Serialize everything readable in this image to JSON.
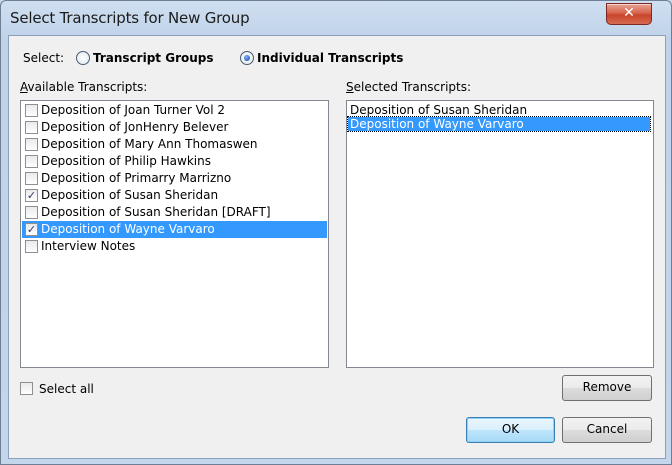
{
  "window": {
    "title": "Select Transcripts for New Group",
    "close_glyph": "✕"
  },
  "select": {
    "label": "Select:",
    "options": [
      {
        "label": "Transcript Groups",
        "selected": false
      },
      {
        "label": "Individual Transcripts",
        "selected": true
      }
    ]
  },
  "available": {
    "label_first": "A",
    "label_rest": "vailable Transcripts:",
    "items": [
      {
        "label": "Deposition of Joan Turner Vol 2",
        "checked": false
      },
      {
        "label": "Deposition of JonHenry Belever",
        "checked": false
      },
      {
        "label": "Deposition of Mary Ann Thomaswen",
        "checked": false
      },
      {
        "label": "Deposition of Philip Hawkins",
        "checked": false
      },
      {
        "label": "Deposition of Primarry Marrizno",
        "checked": false
      },
      {
        "label": "Deposition of Susan Sheridan",
        "checked": true
      },
      {
        "label": "Deposition of Susan Sheridan [DRAFT]",
        "checked": false
      },
      {
        "label": "Deposition of Wayne Varvaro",
        "checked": true,
        "highlighted": true
      },
      {
        "label": "Interview Notes",
        "checked": false
      }
    ]
  },
  "selected": {
    "label_first": "S",
    "label_rest": "elected Transcripts:",
    "items": [
      {
        "label": "Deposition of Susan Sheridan"
      },
      {
        "label": "Deposition of Wayne Varvaro",
        "highlighted": true
      }
    ]
  },
  "select_all": {
    "label": "Select all",
    "checked": false
  },
  "buttons": {
    "remove": "Remove",
    "ok": "OK",
    "cancel": "Cancel"
  },
  "colors": {
    "selection": "#3399ff",
    "check": "#2a3a64"
  }
}
